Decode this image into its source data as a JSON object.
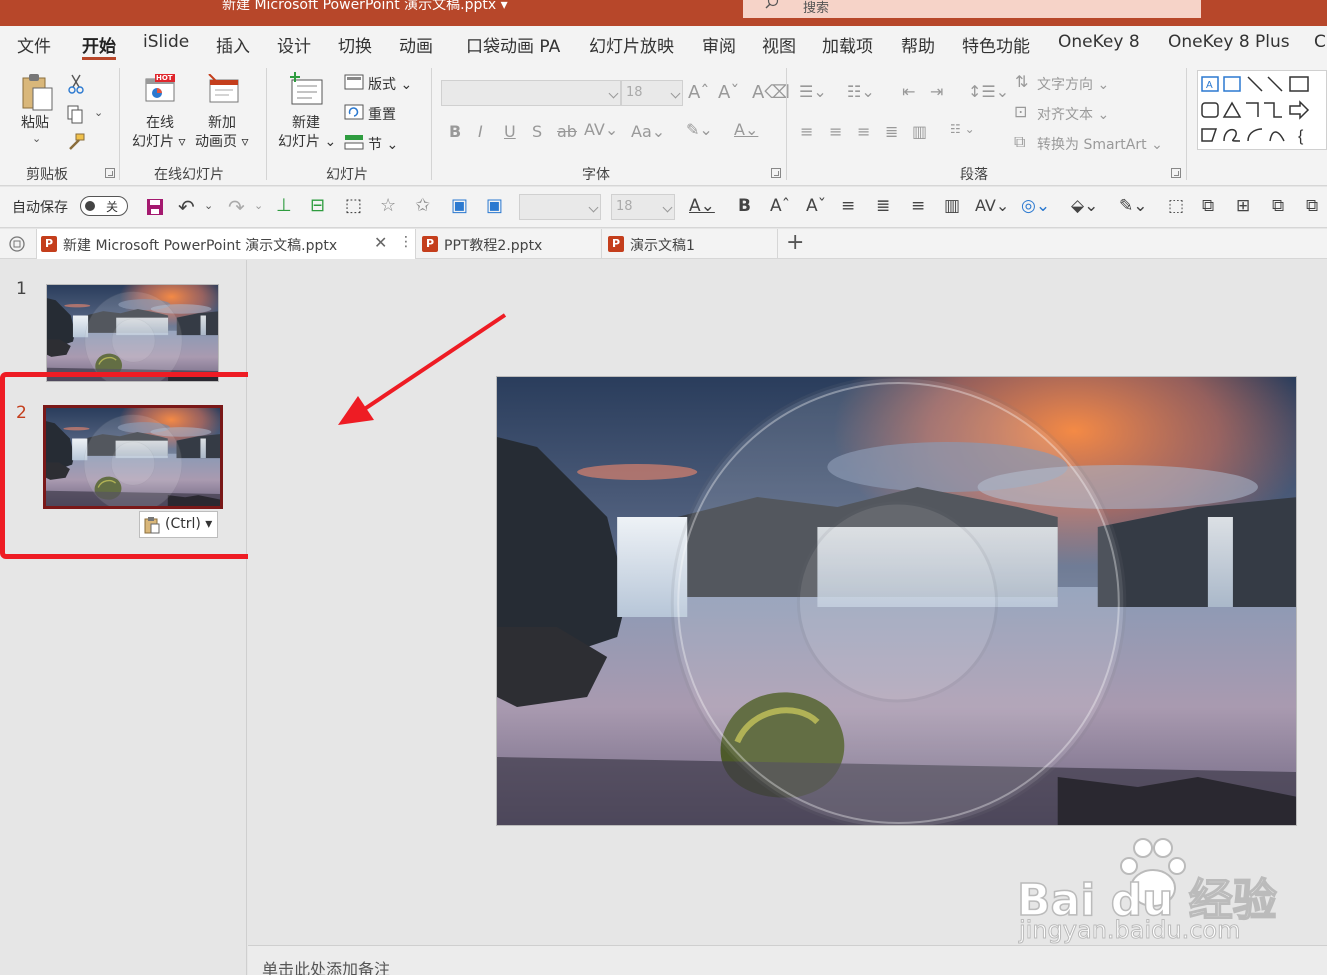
{
  "titlebar": {
    "title": "新建 Microsoft PowerPoint 演示文稿.pptx ▾",
    "search": "搜索"
  },
  "menu": {
    "tabs": [
      "文件",
      "开始",
      "iSlide",
      "插入",
      "设计",
      "切换",
      "动画",
      "口袋动画 PA",
      "幻灯片放映",
      "审阅",
      "视图",
      "加载项",
      "帮助",
      "特色功能",
      "OneKey 8",
      "OneKey 8 Plus",
      "C"
    ],
    "active": "开始"
  },
  "ribbon": {
    "clipboard": {
      "label": "剪贴板",
      "paste": "粘贴"
    },
    "online_slides": {
      "label": "在线幻灯片",
      "online_btn_line1": "在线",
      "online_btn_line2": "幻灯片 ▿",
      "new_anim_line1": "新加",
      "new_anim_line2": "动画页 ▿",
      "hot_badge": "HOT"
    },
    "slides": {
      "label": "幻灯片",
      "new_slide_line1": "新建",
      "new_slide_line2": "幻灯片 ⌄",
      "layout": "版式 ⌄",
      "reset": "重置",
      "section": "节 ⌄"
    },
    "font": {
      "label": "字体",
      "size": "18"
    },
    "paragraph": {
      "label": "段落",
      "text_direction": "文字方向 ⌄",
      "align_text": "对齐文本 ⌄",
      "convert_smartart": "转换为 SmartArt ⌄"
    }
  },
  "qat": {
    "autosave": "自动保存",
    "autosave_state": "关",
    "font_size": "18"
  },
  "doc_tabs": [
    {
      "label": "新建 Microsoft PowerPoint 演示文稿.pptx",
      "active": true
    },
    {
      "label": "PPT教程2.pptx",
      "active": false
    },
    {
      "label": "演示文稿1",
      "active": false
    }
  ],
  "slides_panel": {
    "slides": [
      {
        "number": "1",
        "selected": false
      },
      {
        "number": "2",
        "selected": true
      }
    ],
    "paste_options": "(Ctrl) ▾"
  },
  "notes": {
    "placeholder": "单击此处添加备注"
  },
  "watermark": {
    "brand": "Bai du 经验",
    "url": "jingyan.baidu.com"
  },
  "colors": {
    "accent": "#b7472a",
    "highlight": "#ee1c24",
    "selected_slide_number": "#c43e1c"
  }
}
